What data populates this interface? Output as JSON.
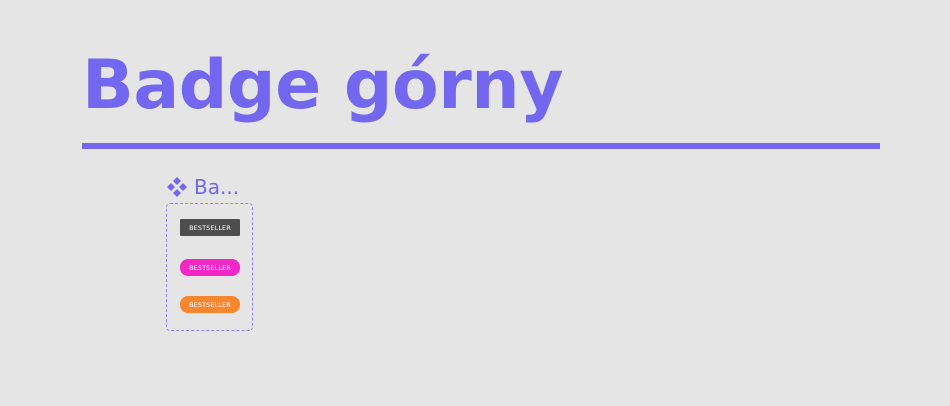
{
  "section": {
    "title": "Badge górny",
    "accent_color": "#7367f0"
  },
  "component": {
    "icon": "component-icon",
    "label": "Ba..."
  },
  "badges": [
    {
      "label": "BESTSELLER",
      "color": "#4d4d4d"
    },
    {
      "label": "BESTSELLER",
      "color": "#f127c6"
    },
    {
      "label": "BESTSELLER",
      "color": "#f6872f"
    }
  ]
}
